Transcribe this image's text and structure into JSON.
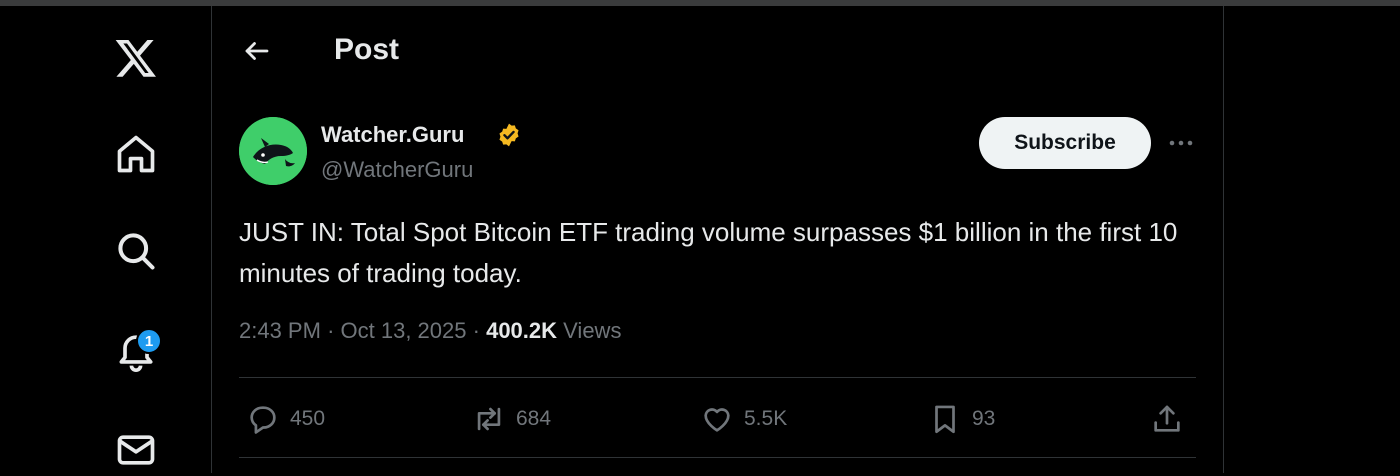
{
  "header": {
    "title": "Post"
  },
  "sidebar": {
    "items": [
      {
        "name": "x-logo",
        "icon": "x-logo-icon"
      },
      {
        "name": "home",
        "icon": "home-icon"
      },
      {
        "name": "explore",
        "icon": "search-icon"
      },
      {
        "name": "notifications",
        "icon": "bell-icon",
        "badge": "1"
      },
      {
        "name": "messages",
        "icon": "envelope-icon"
      }
    ]
  },
  "post": {
    "author_name": "Watcher.Guru",
    "handle": "@WatcherGuru",
    "verified": true,
    "subscribe_label": "Subscribe",
    "text": "JUST IN: Total Spot Bitcoin ETF trading volume surpasses $1 billion in the first 10 minutes of trading today.",
    "time": "2:43 PM",
    "date": "Oct 13, 2025",
    "separator": "·",
    "views_count": "400.2K",
    "views_label": "Views",
    "actions": {
      "replies": "450",
      "reposts": "684",
      "likes": "5.5K",
      "bookmarks": "93"
    }
  },
  "colors": {
    "background": "#000000",
    "text": "#e7e9ea",
    "muted": "#71767b",
    "accent": "#1d9bf0",
    "verified": "#f5b921",
    "avatar": "#3fce6a"
  }
}
